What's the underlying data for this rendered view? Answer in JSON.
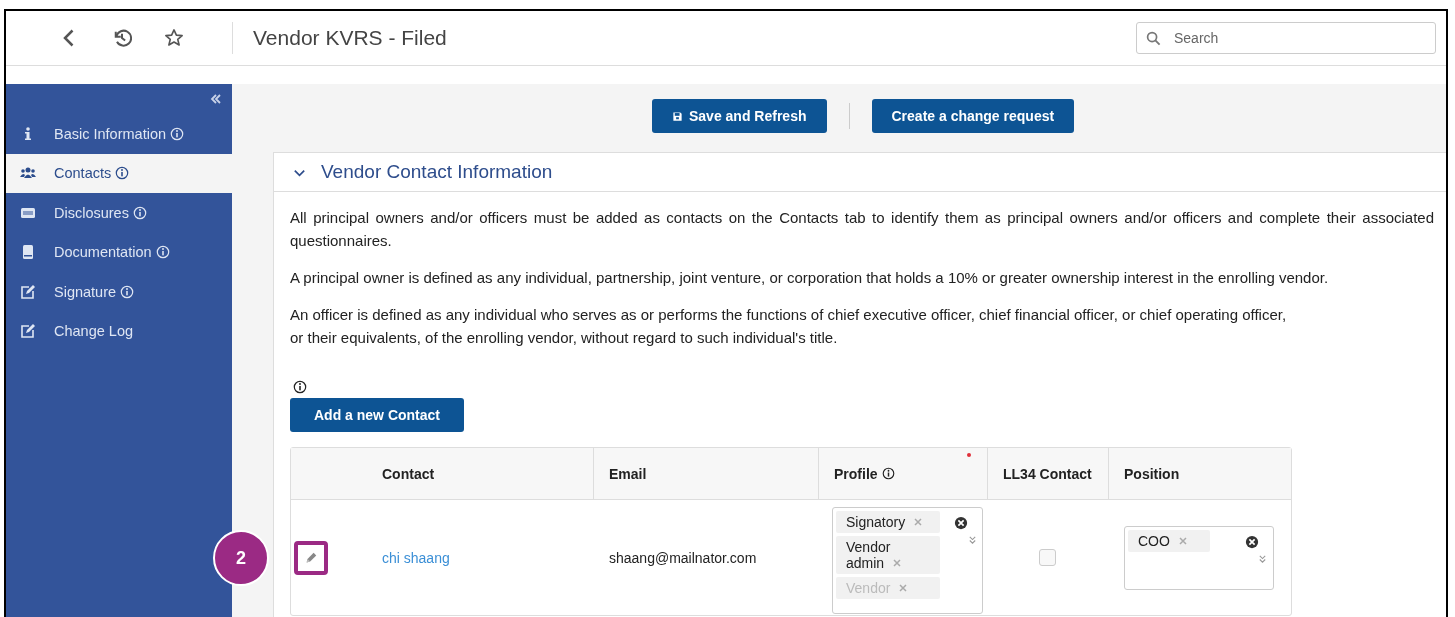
{
  "window": {
    "title": "Vendor KVRS - Filed"
  },
  "search": {
    "placeholder": "Search"
  },
  "sidebar": {
    "items": [
      {
        "label": "Basic Information",
        "kind": "info",
        "info": true,
        "selected": false
      },
      {
        "label": "Contacts",
        "kind": "users",
        "info": true,
        "selected": true
      },
      {
        "label": "Disclosures",
        "kind": "card",
        "info": true,
        "selected": false
      },
      {
        "label": "Documentation",
        "kind": "book",
        "info": true,
        "selected": false
      },
      {
        "label": "Signature",
        "kind": "edit",
        "info": true,
        "selected": false
      },
      {
        "label": "Change Log",
        "kind": "edit",
        "info": false,
        "selected": false
      }
    ]
  },
  "toolbar": {
    "buttons": [
      {
        "label": "Save and Refresh",
        "kind": "save"
      },
      {
        "label": "Create a change request",
        "kind": "plain"
      }
    ]
  },
  "section": {
    "title": "Vendor Contact Information",
    "expanded": true,
    "paragraphs": [
      "All principal owners and/or officers must be added as contacts on the Contacts tab to identify them as principal owners and/or officers and complete their associated questionnaires.",
      "A principal owner is defined as any individual, partnership, joint venture, or corporation that holds a 10% or greater ownership interest in the enrolling vendor.",
      "An officer is defined as any individual who serves as or performs the functions of chief executive officer, chief financial officer, or chief operating officer,\nor their equivalents, of the enrolling vendor, without regard to such individual's title."
    ],
    "add_button": "Add a new Contact"
  },
  "table": {
    "columns": [
      {
        "label": "Contact",
        "info": false,
        "required": false
      },
      {
        "label": "Email",
        "info": false,
        "required": false
      },
      {
        "label": "Profile",
        "info": true,
        "required": true
      },
      {
        "label": "LL34 Contact",
        "info": false,
        "required": false
      },
      {
        "label": "Position",
        "info": false,
        "required": false
      }
    ],
    "rows": [
      {
        "contact": "chi shaang",
        "email": "shaang@mailnator.com",
        "profile": [
          "Signatory",
          "Vendor admin",
          "Vendor"
        ],
        "ll34_contact": false,
        "position": [
          "COO"
        ]
      }
    ]
  },
  "callout": {
    "number": "2"
  }
}
